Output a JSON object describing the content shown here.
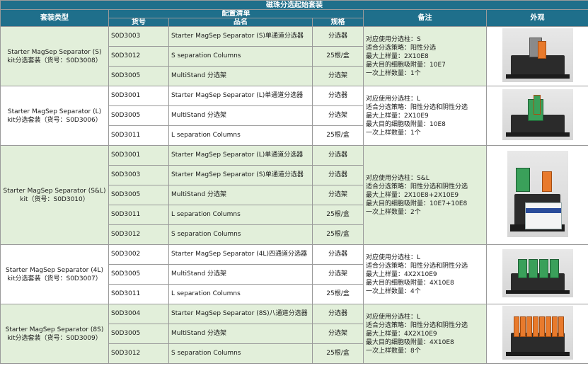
{
  "title": "磁珠分选起始套装",
  "headers": {
    "kit_type": "套装类型",
    "config_list": "配置清单",
    "code": "货号",
    "name": "品名",
    "spec": "规格",
    "remark": "备注",
    "appearance": "外观"
  },
  "kits": [
    {
      "title": "Starter MagSep Separator (S) kit分选套装（货号：S0D3008）",
      "items": [
        {
          "code": "S0D3003",
          "name": "Starter MagSep Separator (S)单通道分选器",
          "spec": "分选器"
        },
        {
          "code": "S0D3012",
          "name": "S separation Columns",
          "spec": "25根/盒"
        },
        {
          "code": "S0D3005",
          "name": "MultiStand 分选架",
          "spec": "分选架"
        }
      ],
      "notes": [
        "对应使用分选柱：S",
        "适合分选策略：阳性分选",
        "最大上样量：2X10E8",
        "最大目的细胞吸附量：10E7",
        "一次上样数量：1个"
      ]
    },
    {
      "title": "Starter MagSep Separator (L) kit分选套装（货号：S0D3006）",
      "items": [
        {
          "code": "S0D3001",
          "name": "Starter MagSep Separator (L)单通道分选器",
          "spec": "分选器"
        },
        {
          "code": "S0D3005",
          "name": "MultiStand 分选架",
          "spec": "分选架"
        },
        {
          "code": "S0D3011",
          "name": "L separation Columns",
          "spec": "25根/盒"
        }
      ],
      "notes": [
        "对应使用分选柱：L",
        "适合分选策略：阳性分选和阴性分选",
        "最大上样量：2X10E9",
        "最大目的细胞吸附量：10E8",
        "一次上样数量：1个"
      ]
    },
    {
      "title": "Starter MagSep Separator (S&L) kit（货号：S0D3010）",
      "items": [
        {
          "code": "S0D3001",
          "name": "Starter MagSep Separator (L)单通道分选器",
          "spec": "分选器"
        },
        {
          "code": "S0D3003",
          "name": "Starter MagSep Separator (S)单通道分选器",
          "spec": "分选器"
        },
        {
          "code": "S0D3005",
          "name": "MultiStand 分选架",
          "spec": "分选架"
        },
        {
          "code": "S0D3011",
          "name": "L separation Columns",
          "spec": "25根/盒"
        },
        {
          "code": "S0D3012",
          "name": "S separation Columns",
          "spec": "25根/盒"
        }
      ],
      "notes": [
        "对应使用分选柱：S&L",
        "适合分选策略：阳性分选和阴性分选",
        "最大上样量：2X10E8+2X10E9",
        "最大目的细胞吸附量：10E7+10E8",
        "一次上样数量：2个"
      ]
    },
    {
      "title": "Starter MagSep Separator (4L) kit分选套装（货号：S0D3007）",
      "items": [
        {
          "code": "S0D3002",
          "name": "Starter MagSep Separator (4L)四通道分选器",
          "spec": "分选器"
        },
        {
          "code": "S0D3005",
          "name": "MultiStand 分选架",
          "spec": "分选架"
        },
        {
          "code": "S0D3011",
          "name": "L separation Columns",
          "spec": "25根/盒"
        }
      ],
      "notes": [
        "对应使用分选柱：L",
        "适合分选策略：阳性分选和阴性分选",
        "最大上样量：4X2X10E9",
        "最大目的细胞吸附量：4X10E8",
        "一次上样数量：4个"
      ]
    },
    {
      "title": "Starter MagSep Separator (8S) kit分选套装（货号：S0D3009）",
      "items": [
        {
          "code": "S0D3004",
          "name": "Starter MagSep Separator (8S)八通道分选器",
          "spec": "分选器"
        },
        {
          "code": "S0D3005",
          "name": "MultiStand 分选架",
          "spec": "分选架"
        },
        {
          "code": "S0D3012",
          "name": "S separation Columns",
          "spec": "25根/盒"
        }
      ],
      "notes": [
        "对应使用分选柱：L",
        "适合分选策略：阳性分选和阴性分选",
        "最大上样量：4X2X10E9",
        "最大目的细胞吸附量：4X10E8",
        "一次上样数量：8个"
      ]
    }
  ]
}
